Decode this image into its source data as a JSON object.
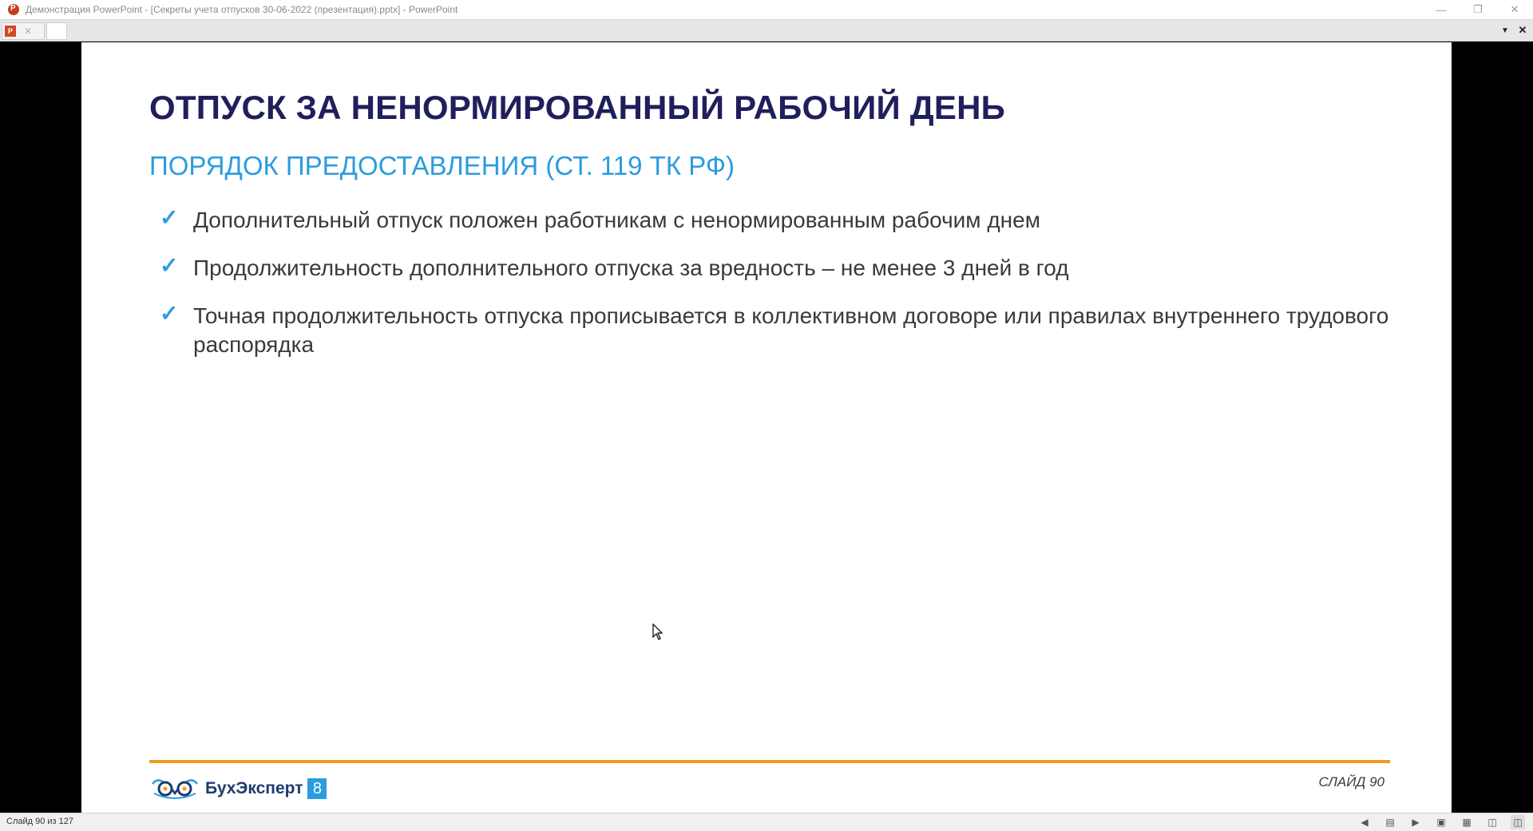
{
  "window": {
    "title": "Демонстрация PowerPoint - [Секреты учета отпусков 30-06-2022 (презентация).pptx] - PowerPoint"
  },
  "slide": {
    "title": "ОТПУСК ЗА НЕНОРМИРОВАННЫЙ РАБОЧИЙ ДЕНЬ",
    "subtitle": "ПОРЯДОК ПРЕДОСТАВЛЕНИЯ (СТ. 119 ТК РФ)",
    "bullets": [
      "Дополнительный отпуск положен работникам с ненормированным рабочим днем",
      "Продолжительность дополнительного отпуска за вредность – не менее 3 дней в год",
      "Точная продолжительность отпуска прописывается в коллективном договоре или правилах внутреннего трудового распорядка"
    ],
    "logo_text": "БухЭксперт",
    "logo_badge": "8",
    "slide_number": "СЛАЙД 90"
  },
  "status": {
    "slide_counter": "Слайд 90 из 127"
  },
  "colors": {
    "title": "#1f1f5c",
    "accent_blue": "#2b9ce0",
    "footer_orange": "#f39a1e"
  }
}
